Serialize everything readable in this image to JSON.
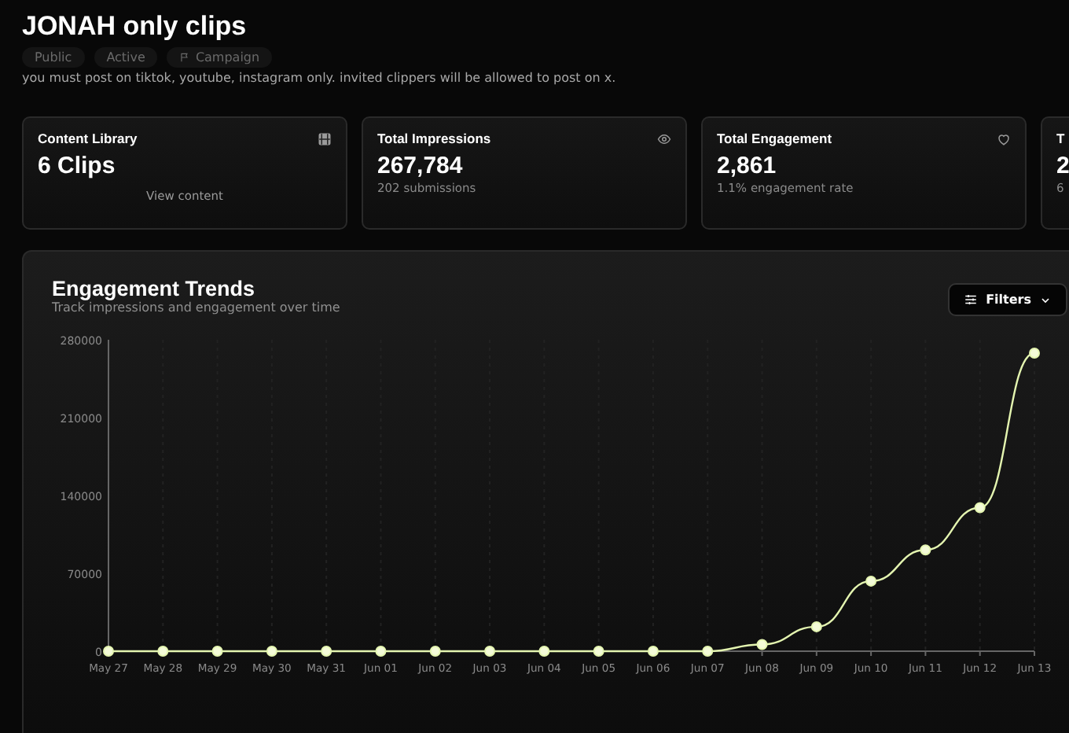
{
  "header": {
    "title": "JONAH only clips",
    "badges": [
      {
        "label": "Public",
        "kind": "plain"
      },
      {
        "label": "Active",
        "kind": "plain"
      },
      {
        "label": "Campaign",
        "kind": "icon"
      }
    ],
    "description": "you must post on tiktok, youtube, instagram only. invited clippers will be allowed to post on x."
  },
  "stats": [
    {
      "title": "Content Library",
      "value": "6 Clips",
      "link": "View content"
    },
    {
      "title": "Total Impressions",
      "value": "267,784",
      "sub": "202 submissions"
    },
    {
      "title": "Total Engagement",
      "value": "2,861",
      "sub": "1.1% engagement rate"
    },
    {
      "title": "T",
      "value": "2",
      "sub": "6"
    }
  ],
  "chart": {
    "title": "Engagement Trends",
    "subtitle": "Track impressions and engagement over time",
    "filter_button": "Filters",
    "chart_data": {
      "type": "line",
      "grid": true,
      "categories": [
        "May 27",
        "May 28",
        "May 29",
        "May 30",
        "May 31",
        "Jun 01",
        "Jun 02",
        "Jun 03",
        "Jun 04",
        "Jun 05",
        "Jun 06",
        "Jun 07",
        "Jun 08",
        "Jun 09",
        "Jun 10",
        "Jun 11",
        "Jun 12",
        "Jun 13"
      ],
      "series": [
        {
          "color": "#e4f5b0",
          "marker": true,
          "values": [
            0,
            0,
            0,
            0,
            0,
            0,
            0,
            0,
            0,
            0,
            0,
            0,
            6000,
            22000,
            63000,
            91000,
            129000,
            268000
          ]
        }
      ],
      "ylim": [
        0,
        280000
      ],
      "yticks": [
        0,
        70000,
        140000,
        210000,
        280000
      ]
    }
  }
}
